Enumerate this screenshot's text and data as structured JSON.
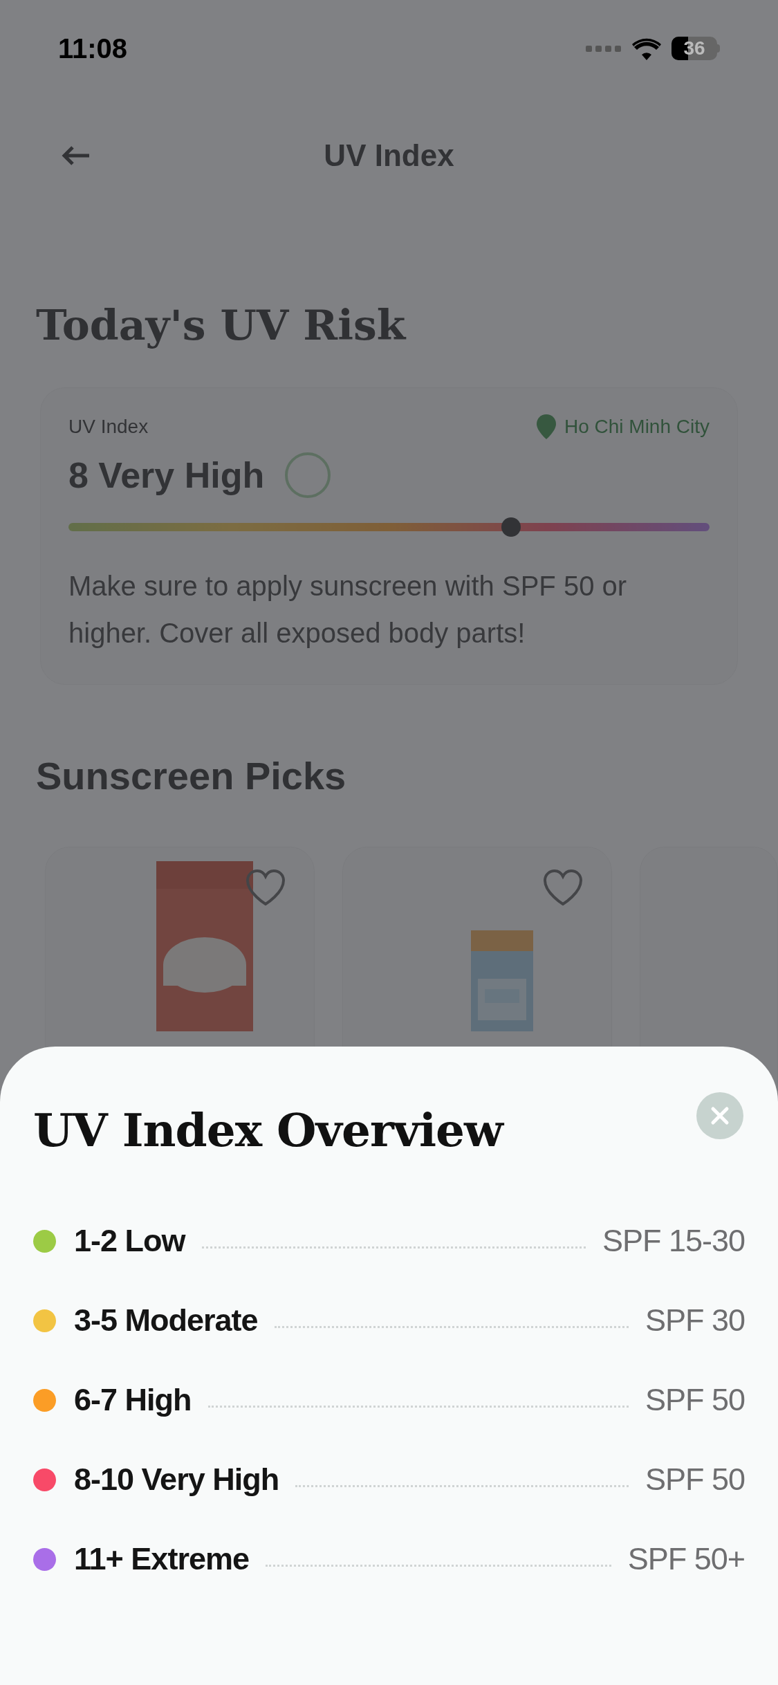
{
  "status_bar": {
    "time": "11:08",
    "battery": "36"
  },
  "header": {
    "title": "UV Index"
  },
  "page_title": "Today's UV Risk",
  "uv_card": {
    "label": "UV Index",
    "value": "8 Very High",
    "location": "Ho Chi Minh City",
    "level": 0.69,
    "advice": "Make sure to apply sunscreen with SPF 50 or higher. Cover all exposed body parts!"
  },
  "section_title": "Sunscreen Picks",
  "sheet": {
    "title": "UV Index Overview",
    "rows": [
      {
        "label": "1-2 Low",
        "spf": "SPF 15-30",
        "color": "#9ccb45"
      },
      {
        "label": "3-5 Moderate",
        "spf": "SPF 30",
        "color": "#f2c443"
      },
      {
        "label": "6-7 High",
        "spf": "SPF 50",
        "color": "#fb9d26"
      },
      {
        "label": "8-10 Very High",
        "spf": "SPF 50",
        "color": "#f84a68"
      },
      {
        "label": "11+ Extreme",
        "spf": "SPF 50+",
        "color": "#a96ee8"
      }
    ]
  }
}
